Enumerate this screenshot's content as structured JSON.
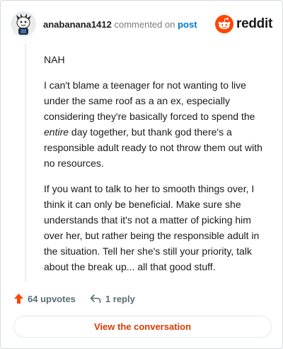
{
  "comment": {
    "username": "anabanana1412",
    "commented_on": "commented on",
    "post_label": "post",
    "paragraphs": [
      "NAH",
      "I can't blame a teenager for not wanting to live under the same roof as a an ex, especially considering they're basically forced to spend the",
      "If you want to talk to her to smooth things over, I think it can only be beneficial. Make sure she understands that it's not a matter of picking him over her, but rather being the responsible adult in the situation. Tell her she's still your priority, talk about the break up... all that good stuff."
    ],
    "emphasis_word": "entire",
    "paragraph_two_end": " day together, but thank god there's a responsible adult ready to not throw them out with no resources."
  },
  "brand": {
    "word": "reddit",
    "icon": "reddit-logo-icon",
    "color": "#ff4500"
  },
  "footer": {
    "upvotes": "64 upvotes",
    "upvote_icon": "upvote-arrow-icon",
    "replies": "1 reply",
    "reply_icon": "reply-arrow-icon"
  },
  "cta": {
    "label": "View the conversation",
    "color": "#d93a00"
  }
}
